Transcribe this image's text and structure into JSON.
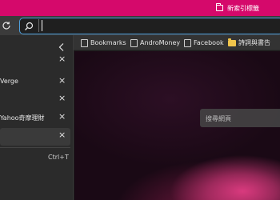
{
  "titlebar": {
    "accent_color": "#d5096b",
    "new_tab_label": "新索引標籤"
  },
  "toolbar": {
    "refresh_icon": "refresh-icon",
    "search_icon": "search-icon",
    "address_value": ""
  },
  "bookmarks": [
    {
      "label": "Bookmarks",
      "icon": "bookmark-icon"
    },
    {
      "label": "AndroMoney",
      "icon": "bookmark-icon"
    },
    {
      "label": "Facebook",
      "icon": "bookmark-icon"
    },
    {
      "label": "詩詞與書告",
      "icon": "folder-icon"
    }
  ],
  "sidebar": {
    "collapse_icon": "chevron-left-icon",
    "tabs": [
      {
        "label": "",
        "active": false
      },
      {
        "label": "Verge",
        "active": false
      },
      {
        "label": "",
        "active": false
      },
      {
        "label": "Yahoo奇摩理財",
        "active": false
      },
      {
        "label": "",
        "active": true
      }
    ],
    "close_label": "×",
    "new_tab_shortcut": "Ctrl+T"
  },
  "content": {
    "search_placeholder": "搜尋網頁"
  }
}
